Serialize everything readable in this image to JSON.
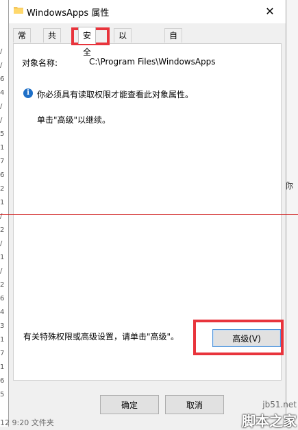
{
  "window": {
    "title": "WindowsApps 属性",
    "close_glyph": "✕"
  },
  "tabs": [
    {
      "label": "常规"
    },
    {
      "label": "共享"
    },
    {
      "label": "安全",
      "active": true
    },
    {
      "label": "以前的版本"
    },
    {
      "label": "自定义"
    }
  ],
  "security": {
    "object_name_label": "对象名称:",
    "object_name_value": "C:\\Program Files\\WindowsApps",
    "info_text": "你必须具有读取权限才能查看此对象属性。",
    "continue_text": "单击\"高级\"以继续。",
    "special_text": "有关特殊权限或高级设置，请单击\"高级\"。",
    "advanced_button": "高级(V)"
  },
  "footer": {
    "ok_label": "确定",
    "cancel_label": "取消"
  },
  "background": {
    "left_rows": [
      "/",
      "/",
      "6",
      "4",
      "/",
      "/",
      "5",
      "1",
      "7",
      "6",
      "2",
      "1",
      "/",
      "2",
      "/",
      "1",
      "/",
      "2",
      "6",
      "4",
      "3",
      "1",
      "7",
      "1",
      "6",
      "5"
    ],
    "status_left": "12 9:20   文件夹",
    "right_text": "你"
  },
  "watermark": {
    "site": "jb51.net",
    "name": "脚本之家"
  },
  "colors": {
    "highlight": "#e8343c",
    "info_icon": "#1e6fc7",
    "focus_border": "#4a90d9"
  }
}
